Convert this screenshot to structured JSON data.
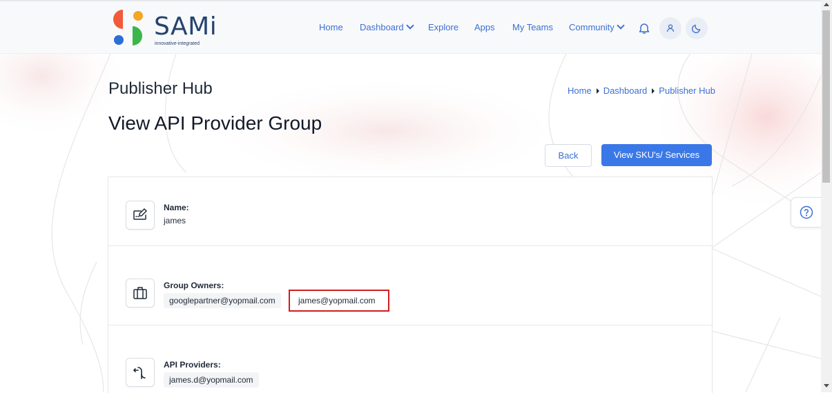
{
  "brand": {
    "name": "SAMi",
    "tagline": "innovative-integrated"
  },
  "nav": {
    "home": "Home",
    "dashboard": "Dashboard",
    "explore": "Explore",
    "apps": "Apps",
    "my_teams": "My Teams",
    "community": "Community"
  },
  "page": {
    "title": "Publisher Hub",
    "subtitle": "View API Provider Group"
  },
  "breadcrumb": [
    "Home",
    "Dashboard",
    "Publisher Hub"
  ],
  "actions": {
    "back": "Back",
    "view_skus": "View SKU's/ Services"
  },
  "details": {
    "name": {
      "label": "Name:",
      "value": "james"
    },
    "group_owners": {
      "label": "Group Owners:",
      "values": [
        "googlepartner@yopmail.com",
        "james@yopmail.com"
      ]
    },
    "api_providers": {
      "label": "API Providers:",
      "values": [
        "james.d@yopmail.com"
      ]
    }
  },
  "colors": {
    "accent": "#3b78e7",
    "link": "#3b6fd3",
    "highlight_border": "#d11c1c",
    "brand_navy": "#24436f"
  },
  "icons": {
    "name": "signature-icon",
    "group_owners": "briefcase-icon",
    "api_providers": "split-arrow-icon",
    "help": "help-circle-icon",
    "notifications": "bell-icon",
    "profile": "user-icon",
    "theme": "moon-icon"
  }
}
